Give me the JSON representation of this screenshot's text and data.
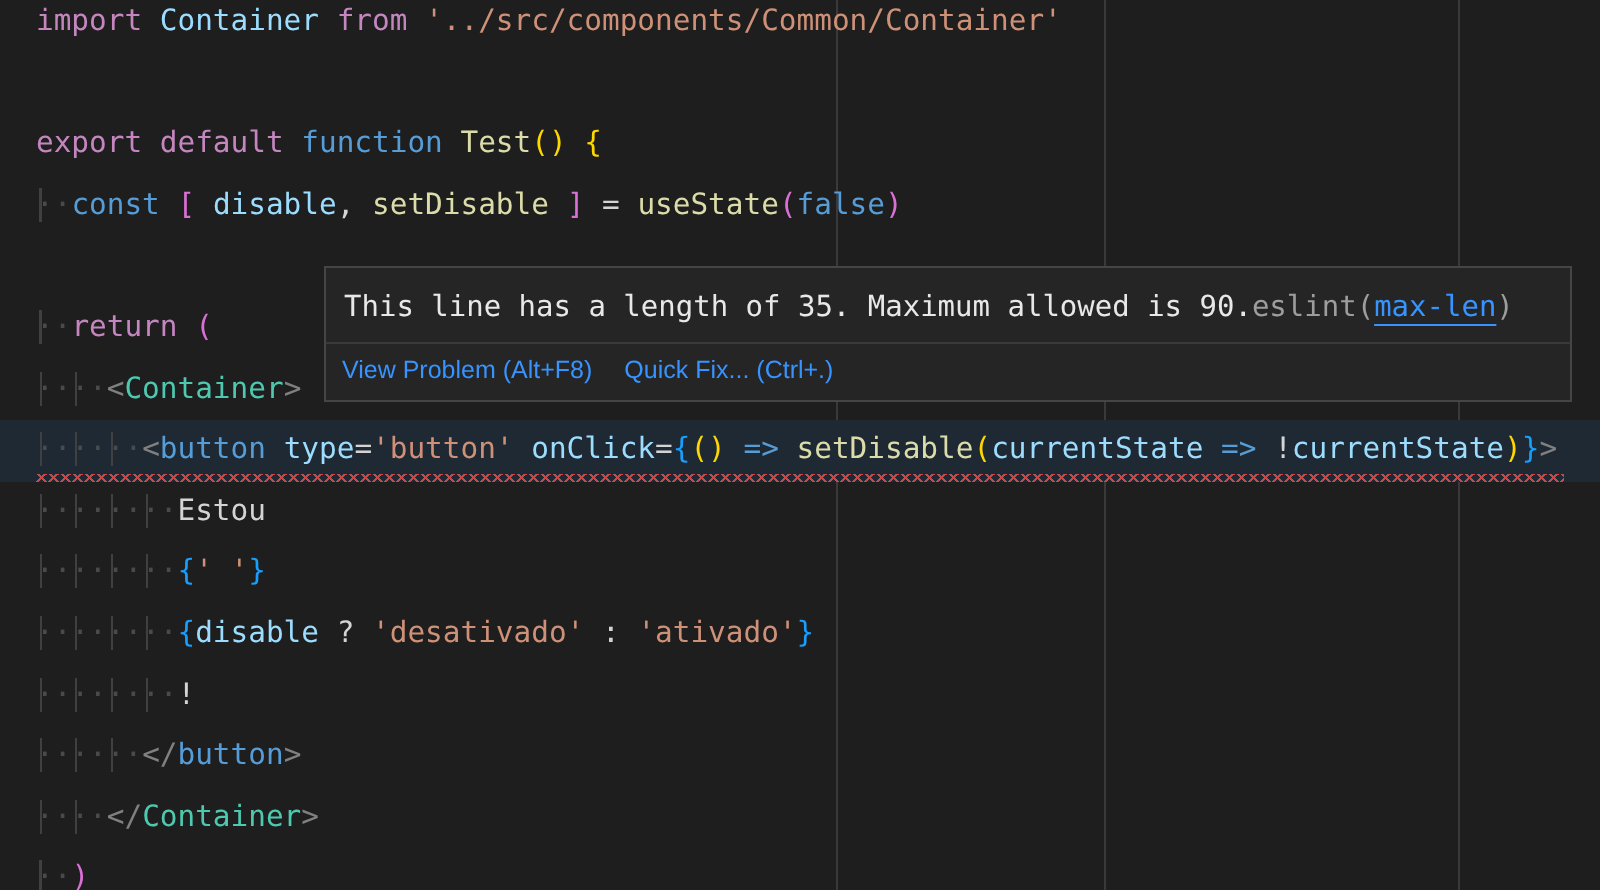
{
  "lines": [
    {
      "kind": "code",
      "tokens": [
        {
          "text": "import ",
          "kind": "keyword"
        },
        {
          "text": "Container ",
          "kind": "variable"
        },
        {
          "text": "from ",
          "kind": "keyword"
        },
        {
          "text": "'../src/components/Common/Container'",
          "kind": "string"
        }
      ]
    },
    {
      "kind": "blank"
    },
    {
      "kind": "code",
      "tokens": [
        {
          "text": "export default ",
          "kind": "keyword"
        },
        {
          "text": "function ",
          "kind": "storage"
        },
        {
          "text": "Test",
          "kind": "function"
        },
        {
          "text": "() {",
          "kind": "bracket"
        }
      ]
    },
    {
      "kind": "code",
      "tokens": [
        {
          "text": "··",
          "kind": "indent"
        },
        {
          "text": "const ",
          "kind": "storage"
        },
        {
          "text": "[ ",
          "kind": "bracket2"
        },
        {
          "text": "disable",
          "kind": "variable"
        },
        {
          "text": ", ",
          "kind": "plain"
        },
        {
          "text": "setDisable ",
          "kind": "function"
        },
        {
          "text": "] ",
          "kind": "bracket2"
        },
        {
          "text": "= ",
          "kind": "plain"
        },
        {
          "text": "useState",
          "kind": "function"
        },
        {
          "text": "(",
          "kind": "bracket2"
        },
        {
          "text": "false",
          "kind": "storage"
        },
        {
          "text": ")",
          "kind": "bracket2"
        }
      ]
    },
    {
      "kind": "blank"
    },
    {
      "kind": "code",
      "tokens": [
        {
          "text": "··",
          "kind": "indent"
        },
        {
          "text": "return ",
          "kind": "keyword"
        },
        {
          "text": "(",
          "kind": "bracket2"
        }
      ]
    },
    {
      "kind": "code",
      "tokens": [
        {
          "text": "····",
          "kind": "indent"
        },
        {
          "text": "<",
          "kind": "punct"
        },
        {
          "text": "Container",
          "kind": "component"
        },
        {
          "text": ">",
          "kind": "punct"
        }
      ]
    },
    {
      "kind": "code",
      "current": true,
      "squiggle": true,
      "tokens": [
        {
          "text": "······",
          "kind": "indent"
        },
        {
          "text": "<",
          "kind": "punct"
        },
        {
          "text": "button ",
          "kind": "storage"
        },
        {
          "text": "type",
          "kind": "variable"
        },
        {
          "text": "=",
          "kind": "plain"
        },
        {
          "text": "'button' ",
          "kind": "string"
        },
        {
          "text": "onClick",
          "kind": "variable"
        },
        {
          "text": "=",
          "kind": "plain"
        },
        {
          "text": "{",
          "kind": "bracket3"
        },
        {
          "text": "() ",
          "kind": "bracket"
        },
        {
          "text": "=> ",
          "kind": "storage"
        },
        {
          "text": "setDisable",
          "kind": "function"
        },
        {
          "text": "(",
          "kind": "bracket"
        },
        {
          "text": "currentState ",
          "kind": "variable"
        },
        {
          "text": "=> ",
          "kind": "storage"
        },
        {
          "text": "!",
          "kind": "plain"
        },
        {
          "text": "currentState",
          "kind": "variable"
        },
        {
          "text": ")",
          "kind": "bracket"
        },
        {
          "text": "}",
          "kind": "bracket3"
        },
        {
          "text": ">",
          "kind": "punct"
        }
      ]
    },
    {
      "kind": "code",
      "tokens": [
        {
          "text": "········",
          "kind": "indent"
        },
        {
          "text": "Estou",
          "kind": "plain"
        }
      ]
    },
    {
      "kind": "code",
      "tokens": [
        {
          "text": "········",
          "kind": "indent"
        },
        {
          "text": "{",
          "kind": "bracket3"
        },
        {
          "text": "' '",
          "kind": "string"
        },
        {
          "text": "}",
          "kind": "bracket3"
        }
      ]
    },
    {
      "kind": "code",
      "tokens": [
        {
          "text": "········",
          "kind": "indent"
        },
        {
          "text": "{",
          "kind": "bracket3"
        },
        {
          "text": "disable ",
          "kind": "variable"
        },
        {
          "text": "? ",
          "kind": "plain"
        },
        {
          "text": "'desativado' ",
          "kind": "string"
        },
        {
          "text": ": ",
          "kind": "plain"
        },
        {
          "text": "'ativado'",
          "kind": "string"
        },
        {
          "text": "}",
          "kind": "bracket3"
        }
      ]
    },
    {
      "kind": "code",
      "tokens": [
        {
          "text": "········",
          "kind": "indent"
        },
        {
          "text": "!",
          "kind": "plain"
        }
      ]
    },
    {
      "kind": "code",
      "tokens": [
        {
          "text": "······",
          "kind": "indent"
        },
        {
          "text": "</",
          "kind": "punct"
        },
        {
          "text": "button",
          "kind": "storage"
        },
        {
          "text": ">",
          "kind": "punct"
        }
      ]
    },
    {
      "kind": "code",
      "tokens": [
        {
          "text": "····",
          "kind": "indent"
        },
        {
          "text": "</",
          "kind": "punct"
        },
        {
          "text": "Container",
          "kind": "component"
        },
        {
          "text": ">",
          "kind": "punct"
        }
      ]
    },
    {
      "kind": "code",
      "tokens": [
        {
          "text": "··",
          "kind": "indent"
        },
        {
          "text": ")",
          "kind": "bracket2"
        }
      ]
    }
  ],
  "hover": {
    "message": "This line has a length of 35. Maximum allowed is 90.",
    "source": "eslint(",
    "rule_link": "max-len",
    "source_end": ")",
    "actions": [
      "View Problem (Alt+F8)",
      "Quick Fix... (Ctrl+.)"
    ]
  }
}
